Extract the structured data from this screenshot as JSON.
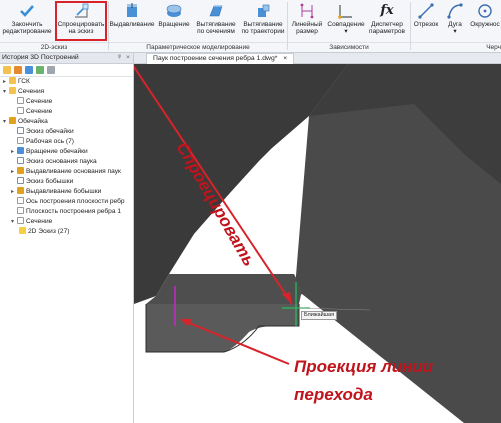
{
  "ribbon": {
    "buttons": [
      {
        "label1": "Закончить",
        "label2": "редактирование"
      },
      {
        "label1": "Спроецировать",
        "label2": "на эскиз"
      },
      {
        "label1": "Выдавливание",
        "label2": ""
      },
      {
        "label1": "Вращение",
        "label2": ""
      },
      {
        "label1": "Вытягивание",
        "label2": "по сечениям"
      },
      {
        "label1": "Вытягивание",
        "label2": "по траектории"
      },
      {
        "label1": "Линейный",
        "label2": "размер"
      },
      {
        "label1": "Совпадение",
        "label2": ""
      },
      {
        "label1": "Диспетчер",
        "label2": "параметров"
      },
      {
        "label1": "Отрезок",
        "label2": ""
      },
      {
        "label1": "Дуга",
        "label2": ""
      },
      {
        "label1": "Окружнос",
        "label2": ""
      }
    ],
    "groups": {
      "sketch": "2D-эскиз",
      "param": "Параметрическое моделирование",
      "deps": "Зависимости",
      "draw": "Черч"
    },
    "fx_glyph": "fx"
  },
  "panel": {
    "title": "История 3D Построений",
    "pin": "ᵠ",
    "close": "×",
    "items": [
      {
        "label": "ГСК",
        "toggle": "▸"
      },
      {
        "label": "Сечения",
        "toggle": "▾"
      },
      {
        "label": "Сечение",
        "toggle": ""
      },
      {
        "label": "Сечение",
        "toggle": ""
      },
      {
        "label": "Обечайка",
        "toggle": "▾"
      },
      {
        "label": "Эскиз обечайки",
        "toggle": ""
      },
      {
        "label": "Рабочая ось (7)",
        "toggle": ""
      },
      {
        "label": "Вращение обечайки",
        "toggle": "▸"
      },
      {
        "label": "Эскиз основания паука",
        "toggle": ""
      },
      {
        "label": "Выдавливание основания паук",
        "toggle": "▸"
      },
      {
        "label": "Эскиз бобышки",
        "toggle": ""
      },
      {
        "label": "Выдавливание бобышки",
        "toggle": "▸"
      },
      {
        "label": "Ось построения плоскости ребр",
        "toggle": ""
      },
      {
        "label": "Плоскость построения ребра 1",
        "toggle": ""
      },
      {
        "label": "Сечение",
        "toggle": "▾"
      },
      {
        "label": "2D Эскиз (27)",
        "toggle": ""
      }
    ]
  },
  "document": {
    "tab_label": "Паук построение сечения ребра 1.dwg*",
    "tab_close": "×"
  },
  "viewport": {
    "snap_label": "Ближайшая",
    "annotation_vertical": "Спроецировать",
    "annotation_bottom_line1": "Проекция линии",
    "annotation_bottom_line2": "перехода"
  },
  "colors": {
    "accent": "#d9232a",
    "part_dark": "#3a3a3a",
    "part_face": "#545454"
  }
}
